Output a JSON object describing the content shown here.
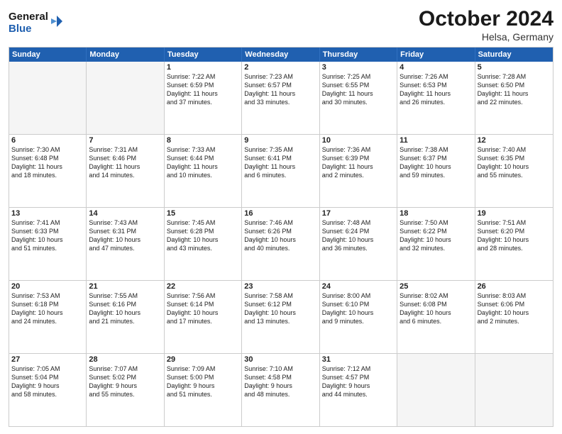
{
  "header": {
    "logo_line1": "General",
    "logo_line2": "Blue",
    "month": "October 2024",
    "location": "Helsa, Germany"
  },
  "weekdays": [
    "Sunday",
    "Monday",
    "Tuesday",
    "Wednesday",
    "Thursday",
    "Friday",
    "Saturday"
  ],
  "rows": [
    [
      {
        "day": "",
        "detail": "",
        "empty": true
      },
      {
        "day": "",
        "detail": "",
        "empty": true
      },
      {
        "day": "1",
        "detail": "Sunrise: 7:22 AM\nSunset: 6:59 PM\nDaylight: 11 hours\nand 37 minutes."
      },
      {
        "day": "2",
        "detail": "Sunrise: 7:23 AM\nSunset: 6:57 PM\nDaylight: 11 hours\nand 33 minutes."
      },
      {
        "day": "3",
        "detail": "Sunrise: 7:25 AM\nSunset: 6:55 PM\nDaylight: 11 hours\nand 30 minutes."
      },
      {
        "day": "4",
        "detail": "Sunrise: 7:26 AM\nSunset: 6:53 PM\nDaylight: 11 hours\nand 26 minutes."
      },
      {
        "day": "5",
        "detail": "Sunrise: 7:28 AM\nSunset: 6:50 PM\nDaylight: 11 hours\nand 22 minutes."
      }
    ],
    [
      {
        "day": "6",
        "detail": "Sunrise: 7:30 AM\nSunset: 6:48 PM\nDaylight: 11 hours\nand 18 minutes."
      },
      {
        "day": "7",
        "detail": "Sunrise: 7:31 AM\nSunset: 6:46 PM\nDaylight: 11 hours\nand 14 minutes."
      },
      {
        "day": "8",
        "detail": "Sunrise: 7:33 AM\nSunset: 6:44 PM\nDaylight: 11 hours\nand 10 minutes."
      },
      {
        "day": "9",
        "detail": "Sunrise: 7:35 AM\nSunset: 6:41 PM\nDaylight: 11 hours\nand 6 minutes."
      },
      {
        "day": "10",
        "detail": "Sunrise: 7:36 AM\nSunset: 6:39 PM\nDaylight: 11 hours\nand 2 minutes."
      },
      {
        "day": "11",
        "detail": "Sunrise: 7:38 AM\nSunset: 6:37 PM\nDaylight: 10 hours\nand 59 minutes."
      },
      {
        "day": "12",
        "detail": "Sunrise: 7:40 AM\nSunset: 6:35 PM\nDaylight: 10 hours\nand 55 minutes."
      }
    ],
    [
      {
        "day": "13",
        "detail": "Sunrise: 7:41 AM\nSunset: 6:33 PM\nDaylight: 10 hours\nand 51 minutes."
      },
      {
        "day": "14",
        "detail": "Sunrise: 7:43 AM\nSunset: 6:31 PM\nDaylight: 10 hours\nand 47 minutes."
      },
      {
        "day": "15",
        "detail": "Sunrise: 7:45 AM\nSunset: 6:28 PM\nDaylight: 10 hours\nand 43 minutes."
      },
      {
        "day": "16",
        "detail": "Sunrise: 7:46 AM\nSunset: 6:26 PM\nDaylight: 10 hours\nand 40 minutes."
      },
      {
        "day": "17",
        "detail": "Sunrise: 7:48 AM\nSunset: 6:24 PM\nDaylight: 10 hours\nand 36 minutes."
      },
      {
        "day": "18",
        "detail": "Sunrise: 7:50 AM\nSunset: 6:22 PM\nDaylight: 10 hours\nand 32 minutes."
      },
      {
        "day": "19",
        "detail": "Sunrise: 7:51 AM\nSunset: 6:20 PM\nDaylight: 10 hours\nand 28 minutes."
      }
    ],
    [
      {
        "day": "20",
        "detail": "Sunrise: 7:53 AM\nSunset: 6:18 PM\nDaylight: 10 hours\nand 24 minutes."
      },
      {
        "day": "21",
        "detail": "Sunrise: 7:55 AM\nSunset: 6:16 PM\nDaylight: 10 hours\nand 21 minutes."
      },
      {
        "day": "22",
        "detail": "Sunrise: 7:56 AM\nSunset: 6:14 PM\nDaylight: 10 hours\nand 17 minutes."
      },
      {
        "day": "23",
        "detail": "Sunrise: 7:58 AM\nSunset: 6:12 PM\nDaylight: 10 hours\nand 13 minutes."
      },
      {
        "day": "24",
        "detail": "Sunrise: 8:00 AM\nSunset: 6:10 PM\nDaylight: 10 hours\nand 9 minutes."
      },
      {
        "day": "25",
        "detail": "Sunrise: 8:02 AM\nSunset: 6:08 PM\nDaylight: 10 hours\nand 6 minutes."
      },
      {
        "day": "26",
        "detail": "Sunrise: 8:03 AM\nSunset: 6:06 PM\nDaylight: 10 hours\nand 2 minutes."
      }
    ],
    [
      {
        "day": "27",
        "detail": "Sunrise: 7:05 AM\nSunset: 5:04 PM\nDaylight: 9 hours\nand 58 minutes."
      },
      {
        "day": "28",
        "detail": "Sunrise: 7:07 AM\nSunset: 5:02 PM\nDaylight: 9 hours\nand 55 minutes."
      },
      {
        "day": "29",
        "detail": "Sunrise: 7:09 AM\nSunset: 5:00 PM\nDaylight: 9 hours\nand 51 minutes."
      },
      {
        "day": "30",
        "detail": "Sunrise: 7:10 AM\nSunset: 4:58 PM\nDaylight: 9 hours\nand 48 minutes."
      },
      {
        "day": "31",
        "detail": "Sunrise: 7:12 AM\nSunset: 4:57 PM\nDaylight: 9 hours\nand 44 minutes."
      },
      {
        "day": "",
        "detail": "",
        "empty": true
      },
      {
        "day": "",
        "detail": "",
        "empty": true
      }
    ]
  ]
}
